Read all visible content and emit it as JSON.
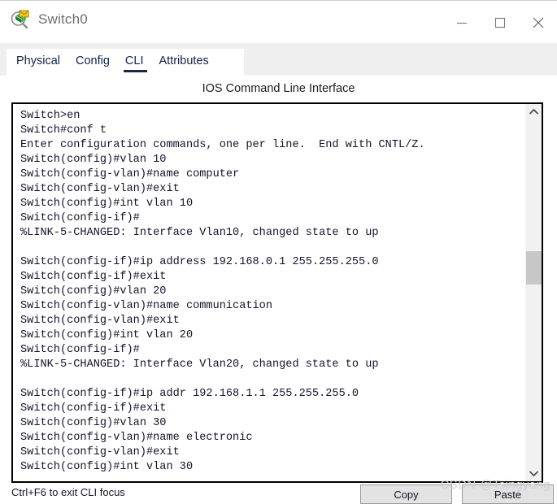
{
  "window": {
    "title": "Switch0",
    "icon": "switch-magnifier-icon",
    "controls": {
      "minimize": "minimize-icon",
      "maximize": "maximize-icon",
      "close": "close-icon"
    }
  },
  "tabs": [
    {
      "label": "Physical",
      "active": false
    },
    {
      "label": "Config",
      "active": false
    },
    {
      "label": "CLI",
      "active": true
    },
    {
      "label": "Attributes",
      "active": false
    }
  ],
  "panel": {
    "title": "IOS Command Line Interface"
  },
  "terminal": {
    "lines": [
      "Switch>en",
      "Switch#conf t",
      "Enter configuration commands, one per line.  End with CNTL/Z.",
      "Switch(config)#vlan 10",
      "Switch(config-vlan)#name computer",
      "Switch(config-vlan)#exit",
      "Switch(config)#int vlan 10",
      "Switch(config-if)#",
      "%LINK-5-CHANGED: Interface Vlan10, changed state to up",
      "",
      "Switch(config-if)#ip address 192.168.0.1 255.255.255.0",
      "Switch(config-if)#exit",
      "Switch(config)#vlan 20",
      "Switch(config-vlan)#name communication",
      "Switch(config-vlan)#exit",
      "Switch(config)#int vlan 20",
      "Switch(config-if)#",
      "%LINK-5-CHANGED: Interface Vlan20, changed state to up",
      "",
      "Switch(config-if)#ip addr 192.168.1.1 255.255.255.0",
      "Switch(config-if)#exit",
      "Switch(config)#vlan 30",
      "Switch(config-vlan)#name electronic",
      "Switch(config-vlan)#exit",
      "Switch(config)#int vlan 30"
    ]
  },
  "scrollbar": {
    "up_arrow": "chevron-up-icon",
    "down_arrow": "chevron-down-icon"
  },
  "bottom": {
    "hint": "Ctrl+F6 to exit CLI focus",
    "copy_label": "Copy",
    "paste_label": "Paste"
  },
  "watermark": "CSDN @Tsingyang",
  "colors": {
    "accent": "#16264f",
    "terminal_text": "#14142b",
    "tab_bg": "#efefef",
    "button_bg": "#e3e3e3"
  }
}
